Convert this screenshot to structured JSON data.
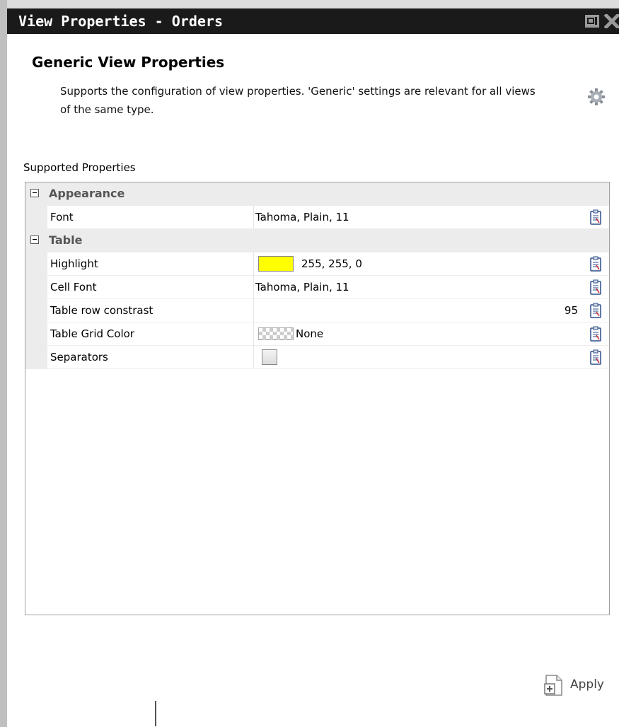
{
  "window": {
    "title": "View Properties - Orders"
  },
  "header": {
    "heading": "Generic View Properties",
    "description": "Supports the configuration of view properties. 'Generic' settings are relevant for all views of the same type.",
    "icon": "gear-icon"
  },
  "section": {
    "label": "Supported Properties"
  },
  "groups": [
    {
      "label": "Appearance",
      "properties": [
        {
          "name": "Font",
          "value": "Tahoma, Plain, 11"
        }
      ]
    },
    {
      "label": "Table",
      "properties": [
        {
          "name": "Highlight",
          "value": "255, 255, 0",
          "color": "#ffff00"
        },
        {
          "name": "Cell Font",
          "value": "Tahoma, Plain, 11"
        },
        {
          "name": "Table row constrast",
          "value": "95"
        },
        {
          "name": "Table Grid Color",
          "value": "None"
        },
        {
          "name": "Separators",
          "checked": false
        }
      ]
    }
  ],
  "footer": {
    "apply_label": "Apply"
  },
  "colors": {
    "titlebar_bg": "#1a1a1a",
    "group_bg": "#ececec",
    "highlight": "#ffff00"
  }
}
